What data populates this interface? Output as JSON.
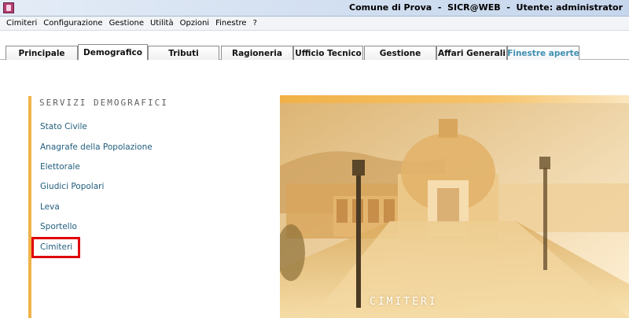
{
  "titlebar": {
    "text": "Comune di Prova  -  SICR@WEB  -  Utente: administrator"
  },
  "menubar": {
    "items": [
      "Cimiteri",
      "Configurazione",
      "Gestione",
      "Utilità",
      "Opzioni",
      "Finestre",
      "?"
    ]
  },
  "tabs": [
    {
      "label": "Principale"
    },
    {
      "label": "Demografico"
    },
    {
      "label": "Tributi"
    },
    {
      "label": "Ragioneria"
    },
    {
      "label": "Ufficio Tecnico"
    },
    {
      "label": "Gestione"
    },
    {
      "label": "Affari Generali"
    },
    {
      "label": "Finestre aperte"
    }
  ],
  "active_tab": "Demografico",
  "sidebar": {
    "title": "SERVIZI DEMOGRAFICI",
    "items": [
      {
        "label": "Stato Civile"
      },
      {
        "label": "Anagrafe della Popolazione"
      },
      {
        "label": "Elettorale"
      },
      {
        "label": "Giudici Popolari"
      },
      {
        "label": "Leva"
      },
      {
        "label": "Sportello"
      },
      {
        "label": "Cimiteri"
      }
    ],
    "highlighted": "Cimiteri"
  },
  "image": {
    "caption": "CIMITERI"
  },
  "colors": {
    "accent": "#f0b34a",
    "link": "#1f5d7d",
    "highlight": "#e10000",
    "tab_light": "#3f8fb0"
  },
  "icons": {
    "app": "app-icon"
  }
}
